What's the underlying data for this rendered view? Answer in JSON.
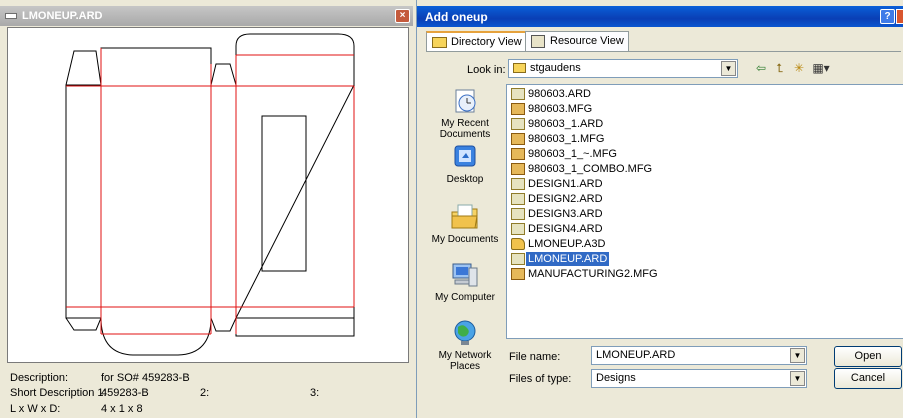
{
  "preview": {
    "title": "LMONEUP.ARD",
    "close_glyph": "×",
    "info": {
      "description_label": "Description:",
      "description_value": "for SO# 459283-B",
      "short_desc_label": "Short Description 1:",
      "short_desc_value": "459283-B",
      "col2_label": "2:",
      "col3_label": "3:",
      "lwd_label": "L x W x D:",
      "lwd_value": "4 x 1 x 8"
    }
  },
  "dialog": {
    "title": "Add oneup",
    "help_glyph": "?",
    "tabs": [
      {
        "label": "Directory View",
        "active": true
      },
      {
        "label": "Resource View",
        "active": false
      }
    ],
    "look_in_label": "Look in:",
    "look_in_value": "stgaudens",
    "toolbar": {
      "back_glyph": "⇦",
      "up_glyph": "⮤",
      "newfolder_glyph": "✳",
      "views_glyph": "▦▾"
    },
    "places": [
      {
        "label": "My Recent Documents",
        "icon": "recent-documents-icon"
      },
      {
        "label": "Desktop",
        "icon": "desktop-icon"
      },
      {
        "label": "My Documents",
        "icon": "my-documents-icon"
      },
      {
        "label": "My Computer",
        "icon": "my-computer-icon"
      },
      {
        "label": "My Network Places",
        "icon": "network-places-icon"
      }
    ],
    "files": [
      {
        "name": "980603.ARD",
        "type": "ard"
      },
      {
        "name": "980603.MFG",
        "type": "mfg"
      },
      {
        "name": "980603_1.ARD",
        "type": "ard"
      },
      {
        "name": "980603_1.MFG",
        "type": "mfg"
      },
      {
        "name": "980603_1_~.MFG",
        "type": "mfg"
      },
      {
        "name": "980603_1_COMBO.MFG",
        "type": "mfg"
      },
      {
        "name": "DESIGN1.ARD",
        "type": "ard"
      },
      {
        "name": "DESIGN2.ARD",
        "type": "ard"
      },
      {
        "name": "DESIGN3.ARD",
        "type": "ard"
      },
      {
        "name": "DESIGN4.ARD",
        "type": "ard"
      },
      {
        "name": "LMONEUP.A3D",
        "type": "a3d"
      },
      {
        "name": "LMONEUP.ARD",
        "type": "ard",
        "selected": true
      },
      {
        "name": "MANUFACTURING2.MFG",
        "type": "mfg"
      }
    ],
    "file_name_label": "File name:",
    "file_name_value": "LMONEUP.ARD",
    "files_of_type_label": "Files of type:",
    "files_of_type_value": "Designs",
    "open_label": "Open",
    "cancel_label": "Cancel",
    "dropdown_glyph": "▼",
    "colors": {
      "title_blue": "#0a3fb5",
      "selection": "#316ac5",
      "dieline_red": "#e01010"
    }
  }
}
